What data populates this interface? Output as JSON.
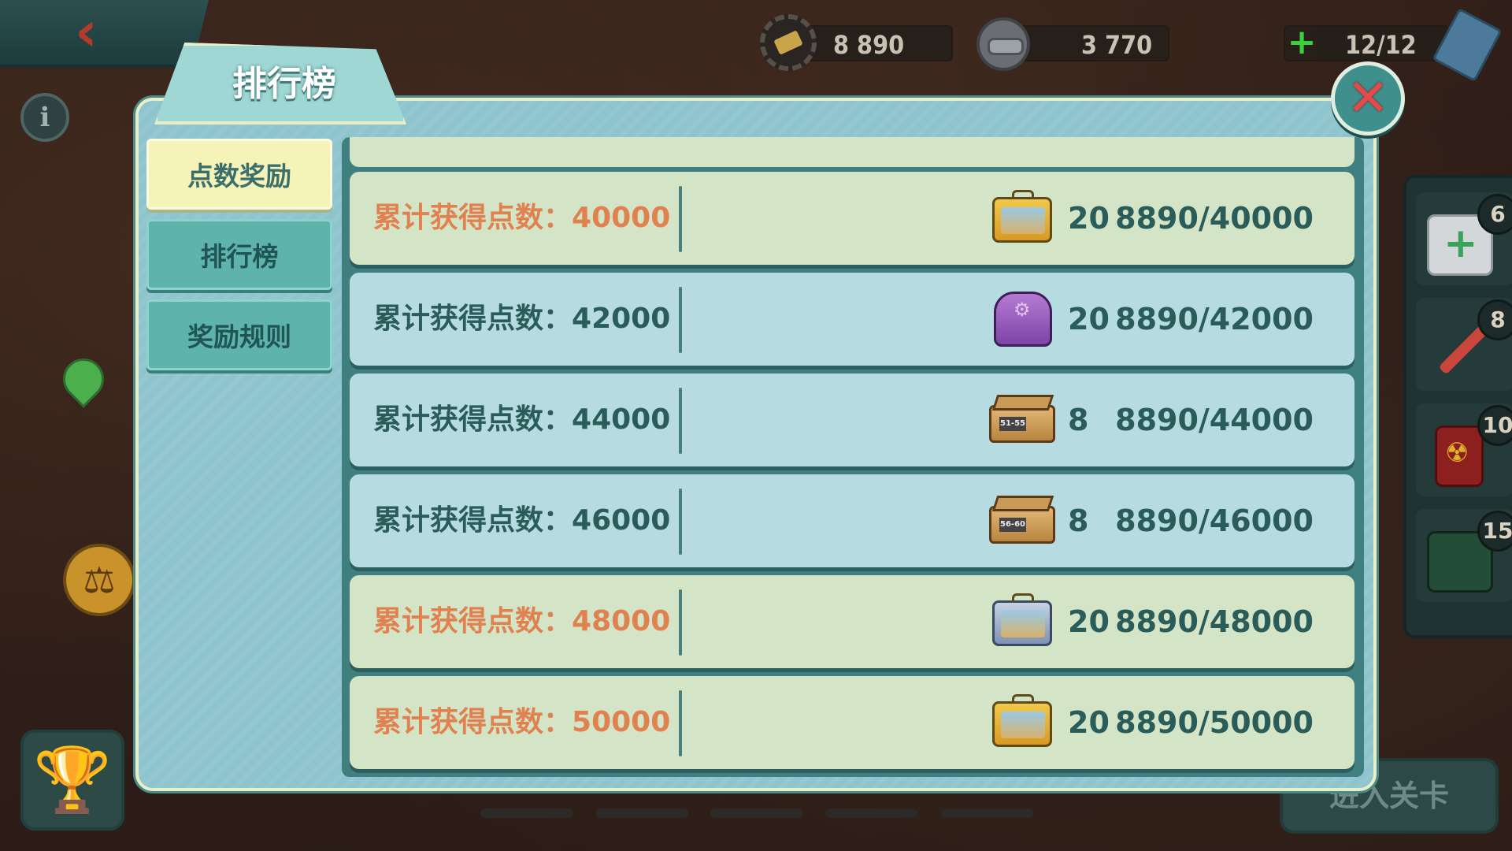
{
  "resources": {
    "gears": "8 890",
    "caps": "3 770",
    "energy": "12/12"
  },
  "modal": {
    "title": "排行榜",
    "close_symbol": "✕"
  },
  "nav": {
    "points_reward": "点数奖励",
    "leaderboard": "排行榜",
    "reward_rules": "奖励规则"
  },
  "rows": [
    {
      "label": "累计获得点数：",
      "points": "40000",
      "icon": "vault-tec-lunchbox-gold",
      "qty": "20",
      "progress": "8890/40000",
      "highlight": true
    },
    {
      "label": "累计获得点数：",
      "points": "42000",
      "icon": "pet-carrier",
      "qty": "20",
      "progress": "8890/42000",
      "highlight": false
    },
    {
      "label": "累计获得点数：",
      "points": "44000",
      "icon": "crate-51-55",
      "icon_text": "51-55",
      "qty": "8",
      "progress": "8890/44000",
      "highlight": false
    },
    {
      "label": "累计获得点数：",
      "points": "46000",
      "icon": "crate-56-60",
      "icon_text": "56-60",
      "qty": "8",
      "progress": "8890/46000",
      "highlight": false
    },
    {
      "label": "累计获得点数：",
      "points": "48000",
      "icon": "vault-tec-lunchbox-silver",
      "qty": "20",
      "progress": "8890/48000",
      "highlight": true
    },
    {
      "label": "累计获得点数：",
      "points": "50000",
      "icon": "vault-tec-lunchbox-gold",
      "qty": "20",
      "progress": "8890/50000",
      "highlight": true
    }
  ],
  "side_items": [
    {
      "name": "medkit",
      "count": "6"
    },
    {
      "name": "stimpak",
      "count": "8"
    },
    {
      "name": "radaway",
      "count": "10"
    },
    {
      "name": "radar",
      "count": "15"
    }
  ],
  "enter_button": "进入关卡"
}
